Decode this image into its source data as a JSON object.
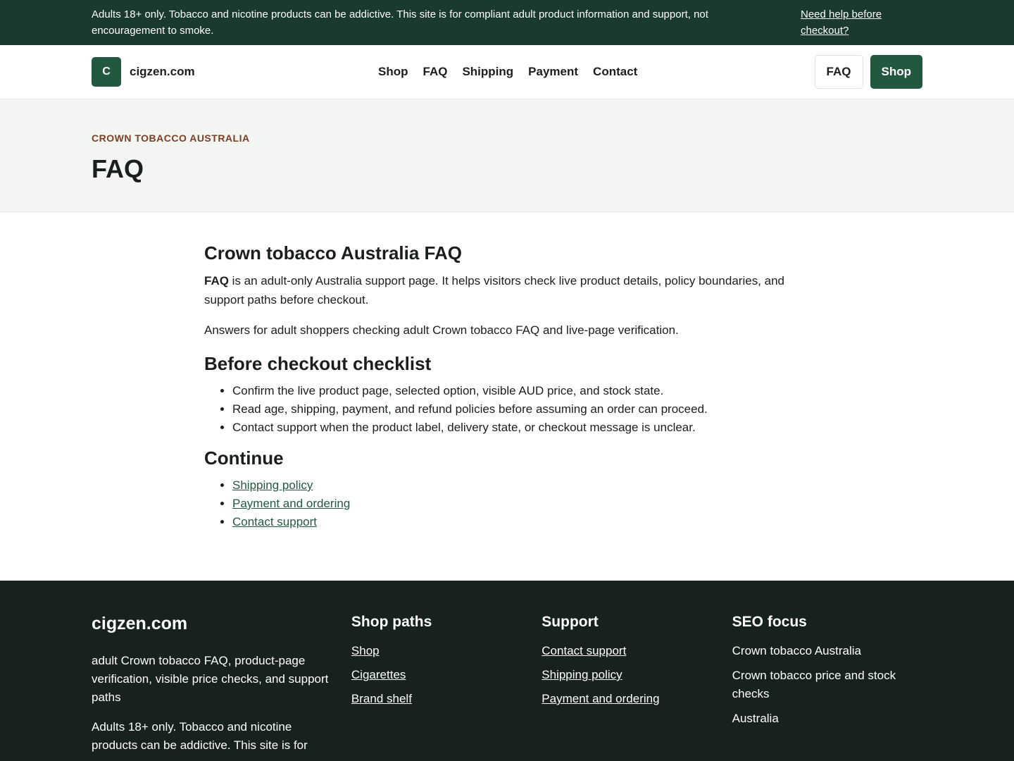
{
  "topbar": {
    "notice": "Adults 18+ only. Tobacco and nicotine products can be addictive. This site is for compliant adult product information and support, not encouragement to smoke.",
    "help_link": "Need help before checkout?"
  },
  "header": {
    "logo_letter": "C",
    "site_name": "cigzen.com",
    "nav": [
      "Shop",
      "FAQ",
      "Shipping",
      "Payment",
      "Contact"
    ],
    "faq_button": "FAQ",
    "shop_button": "Shop"
  },
  "hero": {
    "eyebrow": "CROWN TOBACCO AUSTRALIA",
    "title": "FAQ"
  },
  "main": {
    "heading": "Crown tobacco Australia FAQ",
    "intro_bold": "FAQ",
    "intro_rest": " is an adult-only Australia support page. It helps visitors check live product details, policy boundaries, and support paths before checkout.",
    "answers": "Answers for adult shoppers checking adult Crown tobacco FAQ and live-page verification.",
    "checklist_heading": "Before checkout checklist",
    "checklist": [
      "Confirm the live product page, selected option, visible AUD price, and stock state.",
      "Read age, shipping, payment, and refund policies before assuming an order can proceed.",
      "Contact support when the product label, delivery state, or checkout message is unclear."
    ],
    "continue_heading": "Continue",
    "continue_links": [
      "Shipping policy",
      "Payment and ordering",
      "Contact support"
    ]
  },
  "footer": {
    "brand": "cigzen.com",
    "description": "adult Crown tobacco FAQ, product-page verification, visible price checks, and support paths",
    "note": "Adults 18+ only. Tobacco and nicotine products can be addictive. This site is for",
    "shop_paths_title": "Shop paths",
    "shop_paths": [
      "Shop",
      "Cigarettes",
      "Brand shelf"
    ],
    "support_title": "Support",
    "support_links": [
      "Contact support",
      "Shipping policy",
      "Payment and ordering"
    ],
    "seo_title": "SEO focus",
    "seo_items": [
      "Crown tobacco Australia",
      "Crown tobacco price and stock checks",
      "Australia"
    ]
  },
  "colors": {
    "topbar_bg": "#1b3a2f",
    "brand_green": "#235840",
    "eyebrow": "#7a3f24",
    "footer_bg": "#17211e"
  }
}
